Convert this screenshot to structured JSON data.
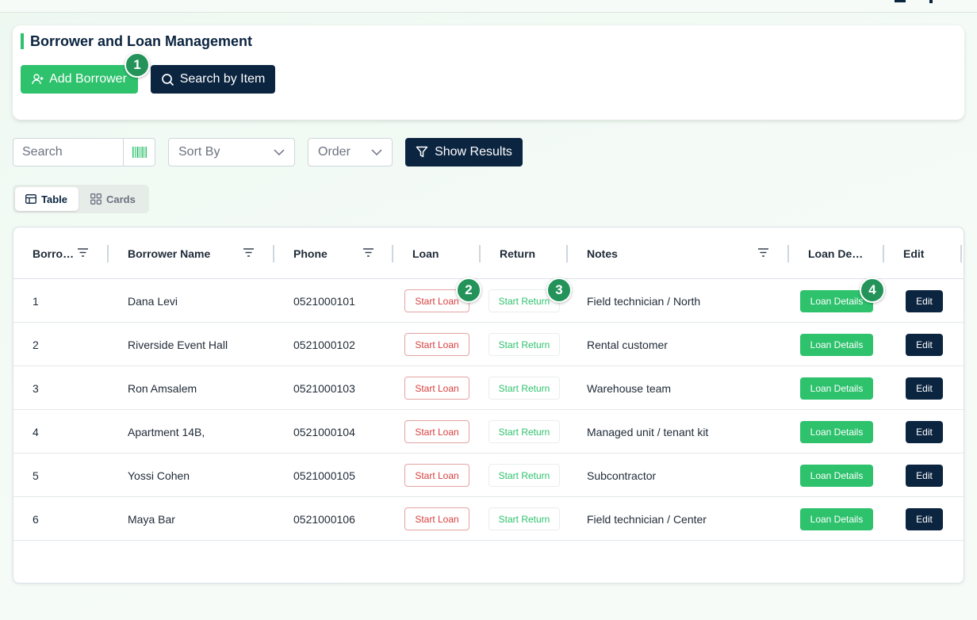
{
  "header": {
    "title": "Borrower and Loan Management",
    "add_borrower_label": "Add Borrower",
    "search_by_item_label": "Search by Item"
  },
  "badges": [
    "1",
    "2",
    "3",
    "4"
  ],
  "filters": {
    "search_placeholder": "Search",
    "sort_by_label": "Sort By",
    "order_label": "Order",
    "show_results_label": "Show Results"
  },
  "view_toggle": {
    "table_label": "Table",
    "cards_label": "Cards",
    "active": "Table"
  },
  "table": {
    "columns": [
      "Borro…",
      "Borrower Name",
      "Phone",
      "Loan",
      "Return",
      "Notes",
      "Loan De…",
      "Edit"
    ],
    "start_loan_label": "Start Loan",
    "start_return_label": "Start Return",
    "loan_details_label": "Loan Details",
    "edit_label": "Edit",
    "rows": [
      {
        "id": "1",
        "name": "Dana Levi",
        "phone": "0521000101",
        "notes": "Field technician / North"
      },
      {
        "id": "2",
        "name": "Riverside Event Hall",
        "phone": "0521000102",
        "notes": "Rental customer"
      },
      {
        "id": "3",
        "name": "Ron Amsalem",
        "phone": "0521000103",
        "notes": "Warehouse team"
      },
      {
        "id": "4",
        "name": "Apartment 14B,",
        "phone": "0521000104",
        "notes": "Managed unit / tenant kit"
      },
      {
        "id": "5",
        "name": "Yossi Cohen",
        "phone": "0521000105",
        "notes": "Subcontractor"
      },
      {
        "id": "6",
        "name": "Maya Bar",
        "phone": "0521000106",
        "notes": "Field technician / Center"
      }
    ]
  },
  "colors": {
    "accent_green": "#2ec26d",
    "navy": "#0b2440",
    "danger_red": "#d84040",
    "badge_green": "#23935a"
  }
}
